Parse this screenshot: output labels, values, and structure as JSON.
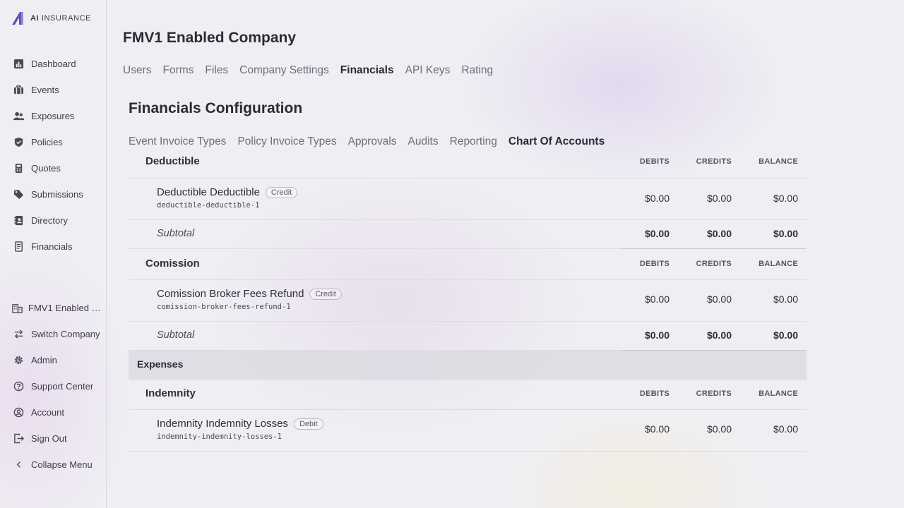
{
  "brand": {
    "logo_bold": "AI",
    "logo_rest": "INSURANCE",
    "accent": "#6a4fb8"
  },
  "sidebar": {
    "items": [
      {
        "label": "Dashboard",
        "icon": "chart-bar-icon"
      },
      {
        "label": "Events",
        "icon": "briefcase-icon"
      },
      {
        "label": "Exposures",
        "icon": "users-icon"
      },
      {
        "label": "Policies",
        "icon": "shield-icon"
      },
      {
        "label": "Quotes",
        "icon": "calculator-icon"
      },
      {
        "label": "Submissions",
        "icon": "tag-icon"
      },
      {
        "label": "Directory",
        "icon": "contact-book-icon"
      },
      {
        "label": "Financials",
        "icon": "receipt-icon"
      }
    ],
    "bottom": [
      {
        "label": "FMV1 Enabled Company",
        "icon": "building-icon"
      },
      {
        "label": "Switch Company",
        "icon": "switch-arrows-icon"
      },
      {
        "label": "Admin",
        "icon": "gear-icon"
      },
      {
        "label": "Support Center",
        "icon": "question-circle-icon"
      },
      {
        "label": "Account",
        "icon": "user-circle-icon"
      },
      {
        "label": "Sign Out",
        "icon": "sign-out-icon"
      },
      {
        "label": "Collapse Menu",
        "icon": "chevron-left-icon"
      }
    ]
  },
  "page": {
    "title": "FMV1 Enabled Company",
    "tabs": [
      "Users",
      "Forms",
      "Files",
      "Company Settings",
      "Financials",
      "API Keys",
      "Rating"
    ],
    "active_tab": "Financials"
  },
  "financials": {
    "title": "Financials Configuration",
    "tabs": [
      "Event Invoice Types",
      "Policy Invoice Types",
      "Approvals",
      "Audits",
      "Reporting",
      "Chart Of Accounts"
    ],
    "active_tab": "Chart Of Accounts"
  },
  "columns": {
    "debits": "DEBITS",
    "credits": "CREDITS",
    "balance": "BALANCE"
  },
  "accounts": {
    "deductible_group": "Deductible",
    "deductible": {
      "name": "Deductible Deductible",
      "type": "Credit",
      "slug": "deductible-deductible-1",
      "debits": "$0.00",
      "credits": "$0.00",
      "balance": "$0.00"
    },
    "deductible_subtotal": {
      "label": "Subtotal",
      "debits": "$0.00",
      "credits": "$0.00",
      "balance": "$0.00"
    },
    "comission_group": "Comission",
    "comission": {
      "name": "Comission Broker Fees Refund",
      "type": "Credit",
      "slug": "comission-broker-fees-refund-1",
      "debits": "$0.00",
      "credits": "$0.00",
      "balance": "$0.00"
    },
    "comission_subtotal": {
      "label": "Subtotal",
      "debits": "$0.00",
      "credits": "$0.00",
      "balance": "$0.00"
    },
    "expenses_category": "Expenses",
    "indemnity_group": "Indemnity",
    "indemnity": {
      "name": "Indemnity Indemnity Losses",
      "type": "Debit",
      "slug": "indemnity-indemnity-losses-1",
      "debits": "$0.00",
      "credits": "$0.00",
      "balance": "$0.00"
    }
  }
}
